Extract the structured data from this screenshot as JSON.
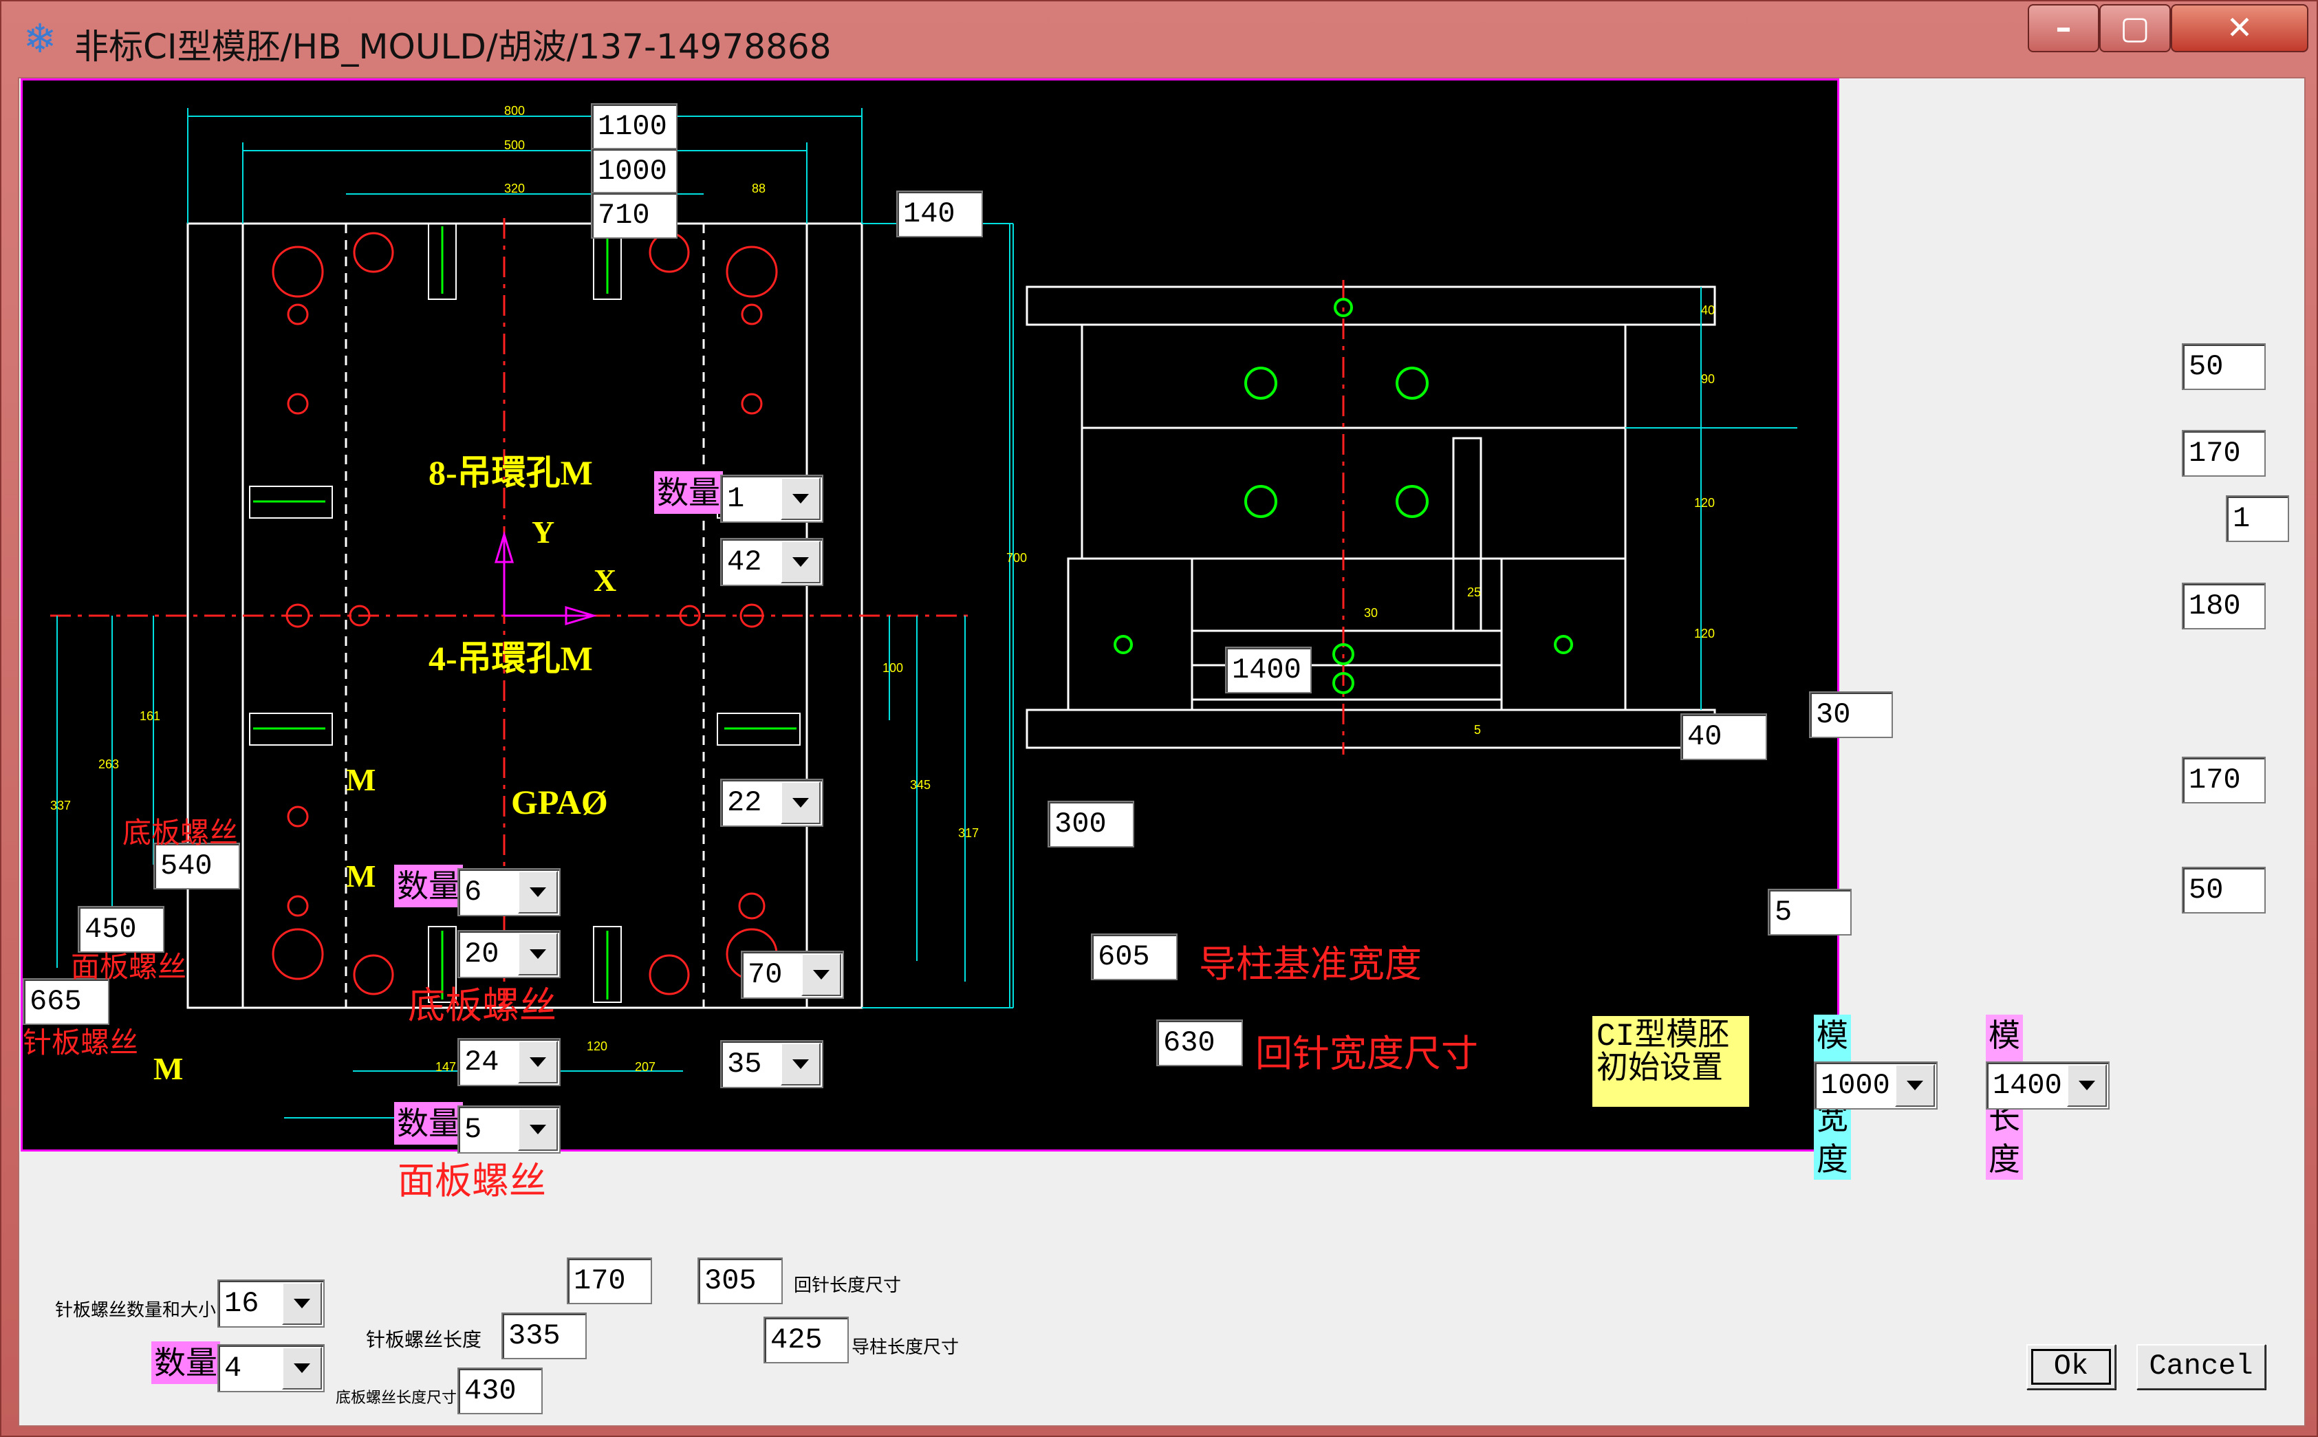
{
  "window": {
    "title": "非标CI型模胚/HB_MOULD/胡波/137-14978868",
    "icon": "snowflake-icon",
    "minimize": "–",
    "maximize": "▢",
    "close": "✕"
  },
  "drawing": {
    "dims": {
      "d1100": "1100",
      "d1000": "1000",
      "d710": "710",
      "d140": "140",
      "d1400": "1400",
      "d40": "40",
      "d300": "300",
      "d605": "605",
      "d630": "630",
      "d540": "540",
      "d450": "450",
      "d665": "665"
    },
    "cad_text": {
      "lift8": "8-吊環孔M",
      "lift4": "4-吊環孔M",
      "gpa": "GPAØ",
      "axis_y": "Y",
      "axis_x": "X",
      "m1": "M",
      "m2": "M",
      "m3": "M"
    },
    "labels": {
      "guide_width": "导柱基准宽度",
      "return_width": "回针宽度尺寸",
      "bottom_screw": "底板螺丝",
      "face_screw": "面板螺丝",
      "pin_screw": "针板螺丝",
      "bottom_screw2": "底板螺丝",
      "face_screw2": "面板螺丝",
      "qty": "数量",
      "qty2": "数量",
      "qty3": "数量"
    },
    "combos": {
      "c1": "1",
      "c42": "42",
      "c22": "22",
      "c6": "6",
      "c20": "20",
      "c70": "70",
      "c24": "24",
      "c35": "35",
      "c5": "5"
    },
    "ci_setup": "CI型模胚\n初始设置",
    "mold_width_label": "模胚宽度",
    "mold_width": "1000",
    "mold_length_label": "模胚长度",
    "mold_length": "1400"
  },
  "right_panel": {
    "r50a": "50",
    "r170a": "170",
    "r1": "1",
    "r180": "180",
    "r30": "30",
    "r170b": "170",
    "r5": "5",
    "r50b": "50"
  },
  "bottom": {
    "pin_screw_qty_label": "针板螺丝数量和大小",
    "pin_screw_qty": "16",
    "qty_label": "数量",
    "qty_value": "4",
    "v170": "170",
    "v305": "305",
    "return_len_label": "回针长度尺寸",
    "pin_screw_len_label": "针板螺丝长度",
    "pin_screw_len": "335",
    "v425": "425",
    "guide_len_label": "导柱长度尺寸",
    "bottom_screw_len_label": "底板螺丝长度尺寸",
    "bottom_screw_len": "430"
  },
  "buttons": {
    "ok": "Ok",
    "cancel": "Cancel"
  }
}
